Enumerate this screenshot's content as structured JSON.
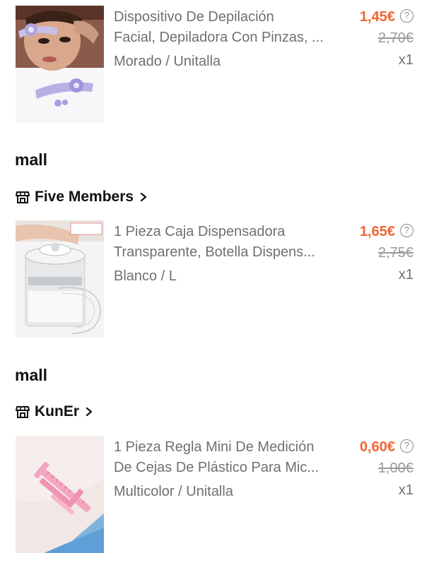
{
  "products": [
    {
      "title_line1": "Dispositivo De Depilación",
      "title_line2": "Facial, Depiladora Con Pinzas, ...",
      "variant": "Morado / Unitalla",
      "price": "1,45€",
      "old_price": "2,70€",
      "quantity": "x1",
      "help_icon": "?"
    },
    {
      "title_line1": "1 Pieza Caja Dispensadora",
      "title_line2": "Transparente, Botella Dispens...",
      "variant": "Blanco / L",
      "price": "1,65€",
      "old_price": "2,75€",
      "quantity": "x1",
      "help_icon": "?"
    },
    {
      "title_line1": "1 Pieza Regla Mini De Medición",
      "title_line2": "De Cejas De Plástico Para Mic...",
      "variant": "Multicolor / Unitalla",
      "price": "0,60€",
      "old_price": "1,00€",
      "quantity": "x1",
      "help_icon": "?"
    }
  ],
  "stores": [
    {
      "section_label": "mall",
      "name": "Five Members",
      "icon": "store-icon",
      "chevron": "chevron-right-icon"
    },
    {
      "section_label": "mall",
      "name": "KunEr",
      "icon": "store-icon",
      "chevron": "chevron-right-icon"
    }
  ],
  "colors": {
    "price": "#f26430",
    "text_secondary": "#707070",
    "text_primary": "#111111",
    "strike": "#9a9a9a"
  }
}
